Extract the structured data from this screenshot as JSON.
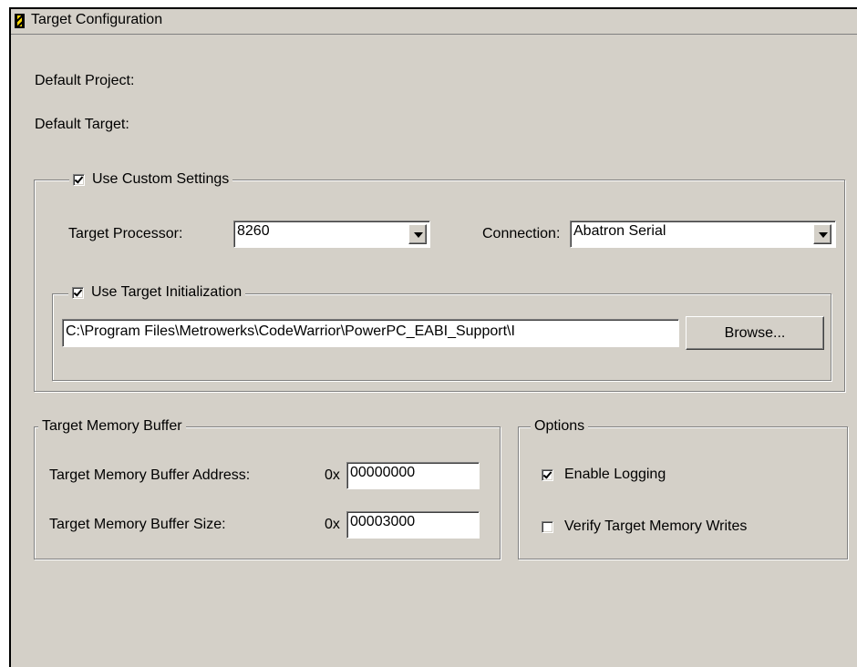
{
  "panel": {
    "title": "Target Configuration"
  },
  "info": {
    "default_project_label": "Default Project:",
    "default_target_label": "Default Target:"
  },
  "custom": {
    "label": "Use Custom Settings",
    "checked": true,
    "processor_label": "Target Processor:",
    "processor_value": "8260",
    "connection_label": "Connection:",
    "connection_value": "Abatron Serial",
    "init": {
      "label": "Use Target Initialization",
      "checked": true,
      "path": "C:\\Program Files\\Metrowerks\\CodeWarrior\\PowerPC_EABI_Support\\I",
      "browse_label": "Browse..."
    }
  },
  "memory": {
    "title": "Target Memory Buffer",
    "address_label": "Target Memory Buffer Address:",
    "address_prefix": "0x",
    "address_value": "00000000",
    "size_label": "Target Memory Buffer Size:",
    "size_prefix": "0x",
    "size_value": "00003000"
  },
  "options": {
    "title": "Options",
    "enable_logging_label": "Enable Logging",
    "enable_logging_checked": true,
    "verify_label": "Verify Target Memory Writes",
    "verify_checked": false
  },
  "colors": {
    "face": "#d4d0c8",
    "window": "#ffffff",
    "shadow": "#808080",
    "title_icon": "#ffd800"
  }
}
